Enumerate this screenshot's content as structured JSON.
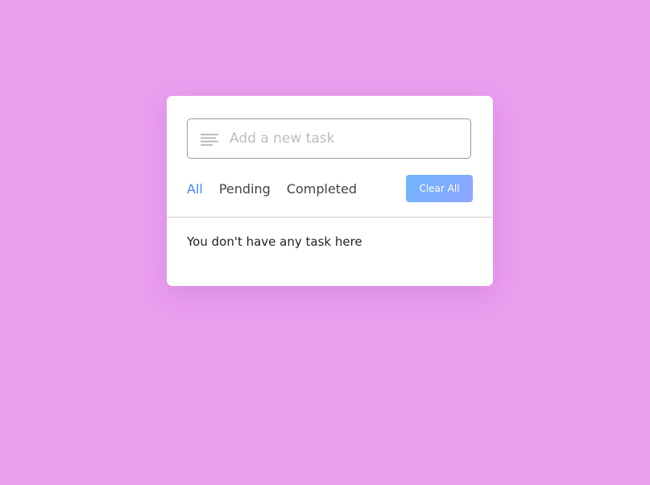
{
  "background_color": "#EA9EEE",
  "accent_color": "#3C87FF",
  "task_input": {
    "icon": "text-lines-icon",
    "placeholder": "Add a new task",
    "value": ""
  },
  "filters": [
    {
      "label": "All",
      "active": true
    },
    {
      "label": "Pending",
      "active": false
    },
    {
      "label": "Completed",
      "active": false
    }
  ],
  "clear_all_label": "Clear All",
  "empty_message": "You don't have any task here"
}
